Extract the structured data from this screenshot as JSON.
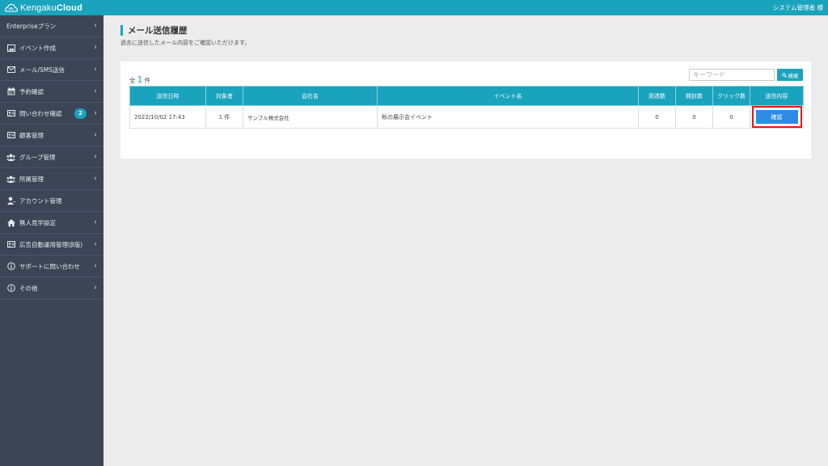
{
  "header": {
    "logo_light": "Kengaku",
    "logo_bold": "Cloud",
    "user_label": "システム管理者 様"
  },
  "sidebar": {
    "items": [
      {
        "label": "Enterpriseプラン",
        "icon": "none",
        "chevron": true
      },
      {
        "label": "イベント作成",
        "icon": "image-icon",
        "chevron": true
      },
      {
        "label": "メール/SMS送信",
        "icon": "envelope-icon",
        "chevron": true
      },
      {
        "label": "予約確認",
        "icon": "calendar-icon",
        "chevron": true
      },
      {
        "label": "問い合わせ確認",
        "icon": "id-card-icon",
        "chevron": true,
        "badge": "2"
      },
      {
        "label": "顧客管理",
        "icon": "id-card-icon",
        "chevron": true
      },
      {
        "label": "グループ管理",
        "icon": "users-icon",
        "chevron": true
      },
      {
        "label": "所属管理",
        "icon": "users-icon",
        "chevron": true
      },
      {
        "label": "アカウント管理",
        "icon": "user-tie-icon",
        "chevron": false
      },
      {
        "label": "無人見学設定",
        "icon": "home-icon",
        "chevron": true
      },
      {
        "label": "広告自動運用管理(β版)",
        "icon": "id-card-icon",
        "chevron": true
      },
      {
        "label": "サポートに問い合わせ",
        "icon": "info-icon",
        "chevron": true
      },
      {
        "label": "その他",
        "icon": "info-icon",
        "chevron": true
      }
    ]
  },
  "page": {
    "title": "メール送信履歴",
    "description": "過去に送信したメール内容をご確認いただけます。",
    "count_prefix": "全",
    "count_value": "1",
    "count_suffix": "件",
    "search_placeholder": "キーワード",
    "search_button": "検索"
  },
  "table": {
    "headers": [
      "送信日時",
      "対象者",
      "会社名",
      "イベント名",
      "到達数",
      "開封数",
      "クリック数",
      "送信内容"
    ],
    "rows": [
      {
        "sent_at": "2022/10/02 17:43",
        "target": "1 件",
        "company": "サンプル株式会社",
        "event": "秋の展示会イベント",
        "delivered": "0",
        "opened": "0",
        "clicks": "0",
        "action": "確認"
      }
    ]
  },
  "colors": {
    "accent": "#1aa3bd",
    "sidebar_bg": "#3b4556",
    "confirm_button": "#2e8be6",
    "highlight_outline": "#e8151b",
    "badge": "#1aa3bd"
  }
}
